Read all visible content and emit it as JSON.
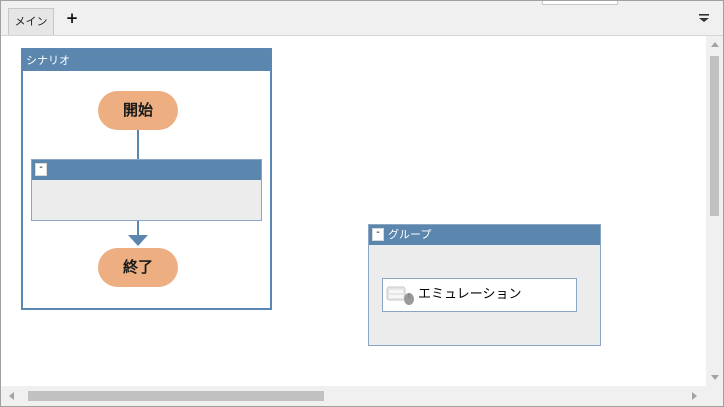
{
  "tabs": [
    {
      "label": "メイン",
      "active": true
    }
  ],
  "tab_add_label": "+",
  "scenario": {
    "title": "シナリオ",
    "start_label": "開始",
    "end_label": "終了",
    "inner_group_collapse": "-"
  },
  "group": {
    "collapse": "-",
    "title": "グループ",
    "action_label": "エミュレーション",
    "action_icon": "emulation-icon"
  },
  "colors": {
    "header_blue": "#5b86ae",
    "node_orange": "#edaf82",
    "group_bg": "#ececec"
  }
}
